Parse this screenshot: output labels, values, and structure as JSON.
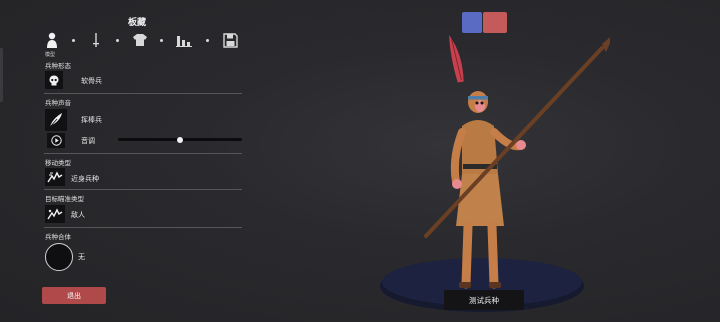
{
  "panel": {
    "title": "板藏"
  },
  "tabs": {
    "items": [
      {
        "icon": "person-icon"
      },
      {
        "icon": "sword-icon"
      },
      {
        "icon": "shirt-icon"
      },
      {
        "icon": "stats-icon"
      },
      {
        "icon": "save-icon"
      }
    ],
    "active_label": "模型"
  },
  "unit_type": {
    "label": "兵种形态",
    "value": "软骨兵",
    "icon": "skull-icon"
  },
  "unit_voice": {
    "label": "兵种声音",
    "value": "挥棒兵",
    "icon": "feather-icon",
    "pitch_label": "音调",
    "pitch_icon": "play-icon",
    "pitch_level": 0.5
  },
  "movement": {
    "label": "移动类型",
    "value": "近身兵种",
    "icon": "movement-icon"
  },
  "targeting": {
    "label": "目标瞄准类型",
    "value": "敌人",
    "icon": "target-icon"
  },
  "unit_combo": {
    "label": "兵种合体",
    "value": "无"
  },
  "exit_label": "退出",
  "colors": {
    "primary": "#5a6bc4",
    "secondary": "#c45a5a",
    "exit": "#b04a4a"
  },
  "test_label": "测试兵种"
}
